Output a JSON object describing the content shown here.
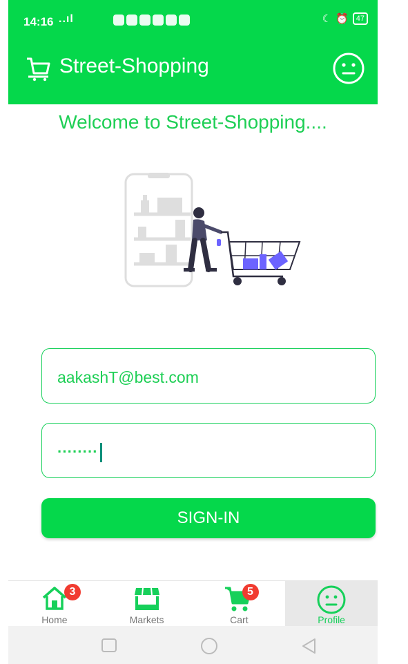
{
  "status_bar": {
    "time": "14:16",
    "signal": "..ıl",
    "battery": "47"
  },
  "app_bar": {
    "title": "Street-Shopping",
    "cart_icon": "shopping-cart-icon",
    "profile_icon": "smiley-face-icon"
  },
  "welcome_text": "Welcome to Street-Shopping....",
  "form": {
    "email_value": "aakashT@best.com",
    "password_mask": "········"
  },
  "sign_in_label": "SIGN-IN",
  "bottom_nav": {
    "items": [
      {
        "label": "Home",
        "icon": "home-icon",
        "badge": "3"
      },
      {
        "label": "Markets",
        "icon": "store-icon",
        "badge": ""
      },
      {
        "label": "Cart",
        "icon": "cart-icon",
        "badge": "5"
      },
      {
        "label": "Profile",
        "icon": "smiley-face-icon",
        "badge": ""
      }
    ],
    "active": "Profile"
  },
  "colors": {
    "primary": "#05d84b",
    "text_green": "#1ecf55",
    "badge": "#f13b30",
    "illustration_accent": "#6c63ff"
  }
}
